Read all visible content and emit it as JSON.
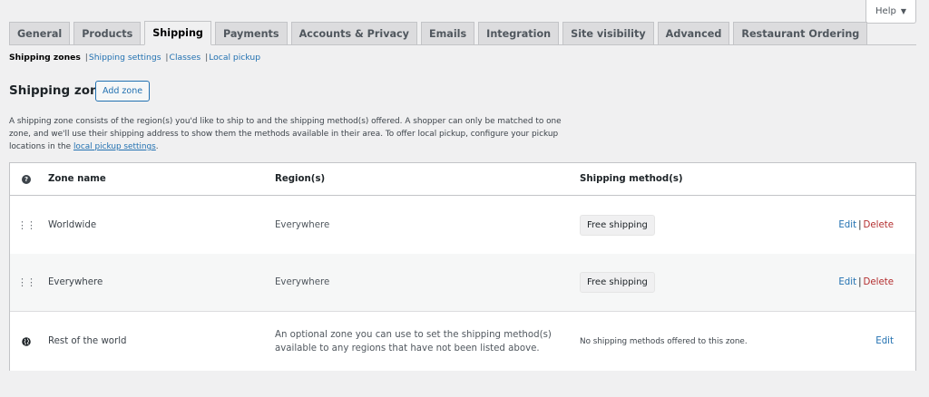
{
  "help": {
    "label": "Help",
    "caret": "▼"
  },
  "tabs": [
    {
      "label": "General",
      "active": false
    },
    {
      "label": "Products",
      "active": false
    },
    {
      "label": "Shipping",
      "active": true
    },
    {
      "label": "Payments",
      "active": false
    },
    {
      "label": "Accounts & Privacy",
      "active": false
    },
    {
      "label": "Emails",
      "active": false
    },
    {
      "label": "Integration",
      "active": false
    },
    {
      "label": "Site visibility",
      "active": false
    },
    {
      "label": "Advanced",
      "active": false
    },
    {
      "label": "Restaurant Ordering",
      "active": false
    }
  ],
  "subnav": {
    "current": "Shipping zones",
    "separator": "|",
    "links": [
      "Shipping settings",
      "Classes",
      "Local pickup"
    ]
  },
  "page": {
    "title": "Shipping zones",
    "add_zone": "Add zone",
    "description_1": "A shipping zone consists of the region(s) you'd like to ship to and the shipping method(s) offered. A shopper can only be matched to one zone, and we'll use their shipping address to show them the methods available in their area. To offer local pickup, configure your pickup locations in the ",
    "description_link": "local pickup settings",
    "description_2": "."
  },
  "table": {
    "help_icon": "?",
    "columns": {
      "name": "Zone name",
      "regions": "Region(s)",
      "methods": "Shipping method(s)"
    },
    "rows": [
      {
        "name": "Worldwide",
        "region": "Everywhere",
        "method": "Free shipping",
        "edit": "Edit",
        "delete": "Delete"
      },
      {
        "name": "Everywhere",
        "region": "Everywhere",
        "method": "Free shipping",
        "edit": "Edit",
        "delete": "Delete"
      }
    ],
    "rest": {
      "name": "Rest of the world",
      "region": "An optional zone you can use to set the shipping method(s) available to any regions that have not been listed above.",
      "method": "No shipping methods offered to this zone.",
      "edit": "Edit"
    },
    "action_separator": "|",
    "drag_glyph": "⋮⋮"
  },
  "colors": {
    "link": "#2271b1",
    "delete": "#b32d2e",
    "border": "#c3c4c7",
    "background": "#f0f0f1"
  }
}
